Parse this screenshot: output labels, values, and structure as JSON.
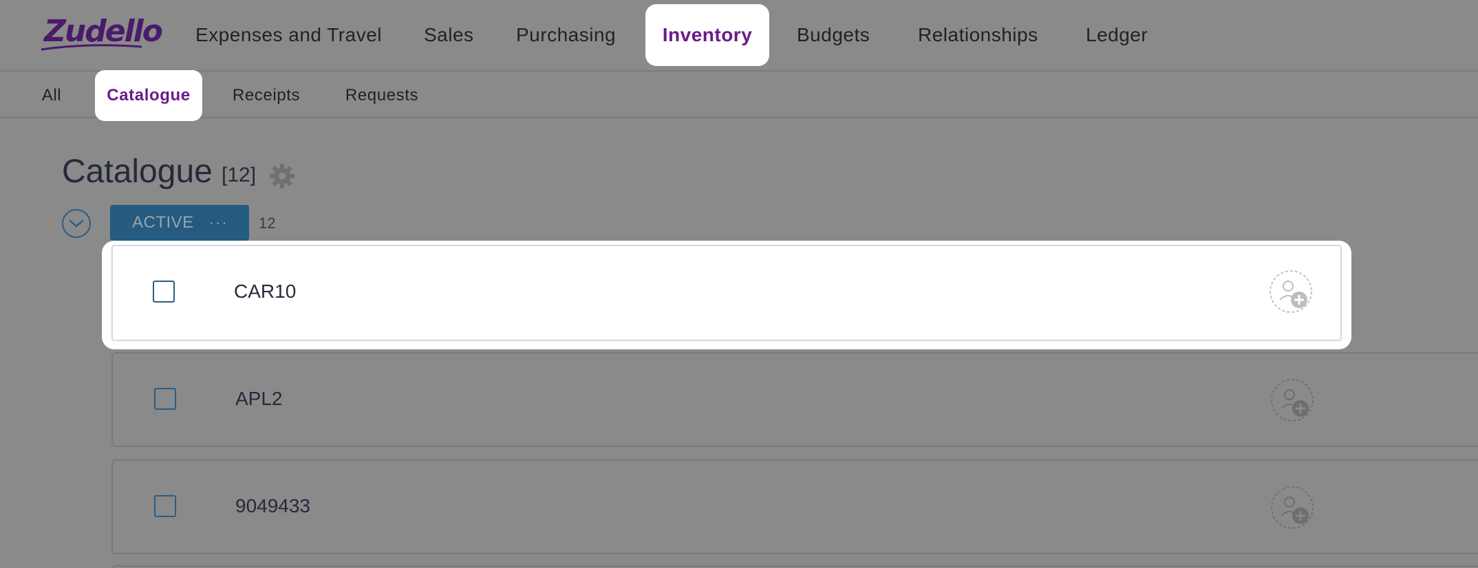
{
  "app": {
    "logo_text": "Zudello"
  },
  "topnav": {
    "items": [
      {
        "label": "Expenses and Travel"
      },
      {
        "label": "Sales"
      },
      {
        "label": "Purchasing"
      },
      {
        "label": "Inventory",
        "active": true
      },
      {
        "label": "Budgets"
      },
      {
        "label": "Relationships"
      },
      {
        "label": "Ledger"
      }
    ]
  },
  "subnav": {
    "items": [
      {
        "label": "All"
      },
      {
        "label": "Catalogue",
        "active": true
      },
      {
        "label": "Receipts"
      },
      {
        "label": "Requests"
      }
    ]
  },
  "page": {
    "title": "Catalogue",
    "count_label": "[12]"
  },
  "group": {
    "status_label": "ACTIVE",
    "more_label": "···",
    "count": "12"
  },
  "rows": [
    {
      "label": "CAR10"
    },
    {
      "label": "APL2"
    },
    {
      "label": "9049433"
    }
  ],
  "colors": {
    "accent": "#6a1b8a",
    "status_pill": "#255b80",
    "overlay_bg": "#8a8a8a"
  }
}
